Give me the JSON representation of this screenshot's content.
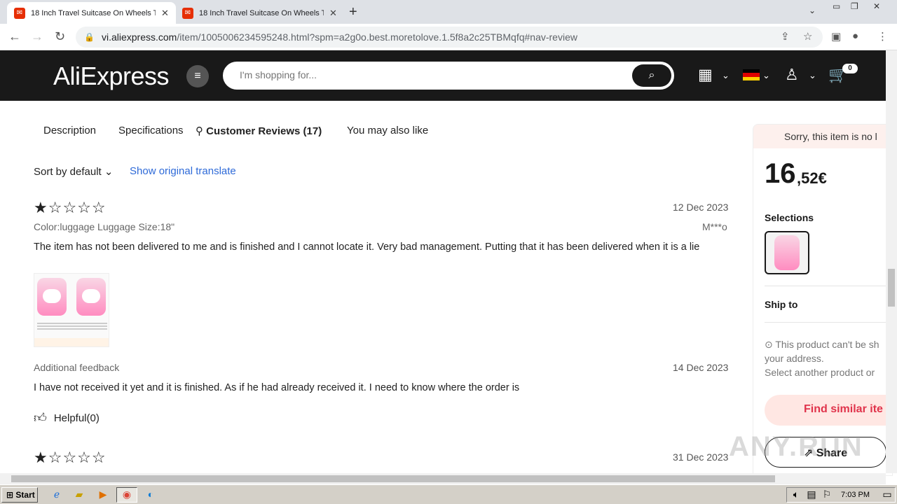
{
  "browser": {
    "tabs": [
      {
        "title": "18 Inch Travel Suitcase On Wheels Tr"
      },
      {
        "title": "18 Inch Travel Suitcase On Wheels Tr"
      }
    ],
    "url_host": "vi.aliexpress.com",
    "url_path": "/item/1005006234595248.html?spm=a2g0o.best.moretolove.1.5f8a2c25TBMqfq#nav-review"
  },
  "site": {
    "logo": "AliExpress",
    "search_placeholder": "I'm shopping for...",
    "cart_count": "0"
  },
  "page_tabs": [
    {
      "label": "Description"
    },
    {
      "label": "Specifications"
    },
    {
      "label": "Customer Reviews (17)"
    },
    {
      "label": "You may also like"
    }
  ],
  "controls": {
    "sort": "Sort by default",
    "translate": "Show original translate"
  },
  "reviews": [
    {
      "stars": "★☆☆☆☆",
      "rating": 1,
      "date": "12 Dec 2023",
      "variant": "Color:luggage Luggage Size:18\"",
      "author": "M***o",
      "text": "The item has not been delivered to me and is finished and I cannot locate it. Very bad management. Putting that it has been delivered when it is a lie",
      "additional_label": "Additional feedback",
      "additional_date": "14 Dec 2023",
      "additional_text": "I have not received it yet and it is finished. As if he had already received it. I need to know where the order is",
      "helpful": "Helpful(0)"
    },
    {
      "stars": "★☆☆☆☆",
      "rating": 1,
      "date": "31 Dec 2023"
    }
  ],
  "panel": {
    "notice": "Sorry, this item is no l",
    "price_int": "16",
    "price_dec": ",52€",
    "selections_label": "Selections",
    "ship_to_label": "Ship to",
    "ship_line1": "⊙ This product can't be sh",
    "ship_line2": "your address.",
    "ship_line3": "Select another product or",
    "find_similar": "Find similar ite",
    "share": "Share"
  },
  "taskbar": {
    "start": "Start",
    "clock": "7:03 PM"
  },
  "watermark": "ANY.RUN",
  "colors": {
    "header_bg": "#191919",
    "accent_red": "#e0334b",
    "link_blue": "#2e6ad8"
  }
}
